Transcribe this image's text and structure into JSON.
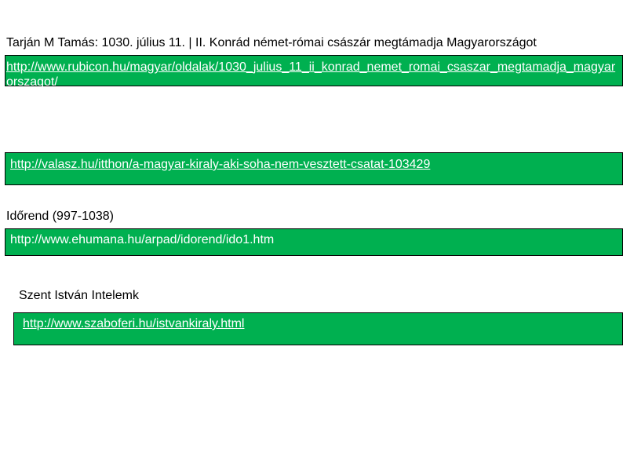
{
  "items": [
    {
      "heading": "Tarján M Tamás: 1030. július 11. | II. Konrád német-római császár megtámadja Magyarországot",
      "link": "http://www.rubicon.hu/magyar/oldalak/1030_julius_11_ii_konrad_nemet_romai_csaszar_megtamadja_magyarorszagot/"
    },
    {
      "heading": "",
      "link": "http://valasz.hu/itthon/a-magyar-kiraly-aki-soha-nem-vesztett-csatat-103429"
    },
    {
      "heading": "Időrend (997-1038)",
      "link": "http://www.ehumana.hu/arpad/idorend/ido1.htm"
    },
    {
      "heading": "Szent István Intelemk",
      "link": "http://www.szaboferi.hu/istvankiraly.html"
    }
  ],
  "colors": {
    "box_fill": "#00b050",
    "box_border": "#000000",
    "link_text": "#ffffff"
  }
}
